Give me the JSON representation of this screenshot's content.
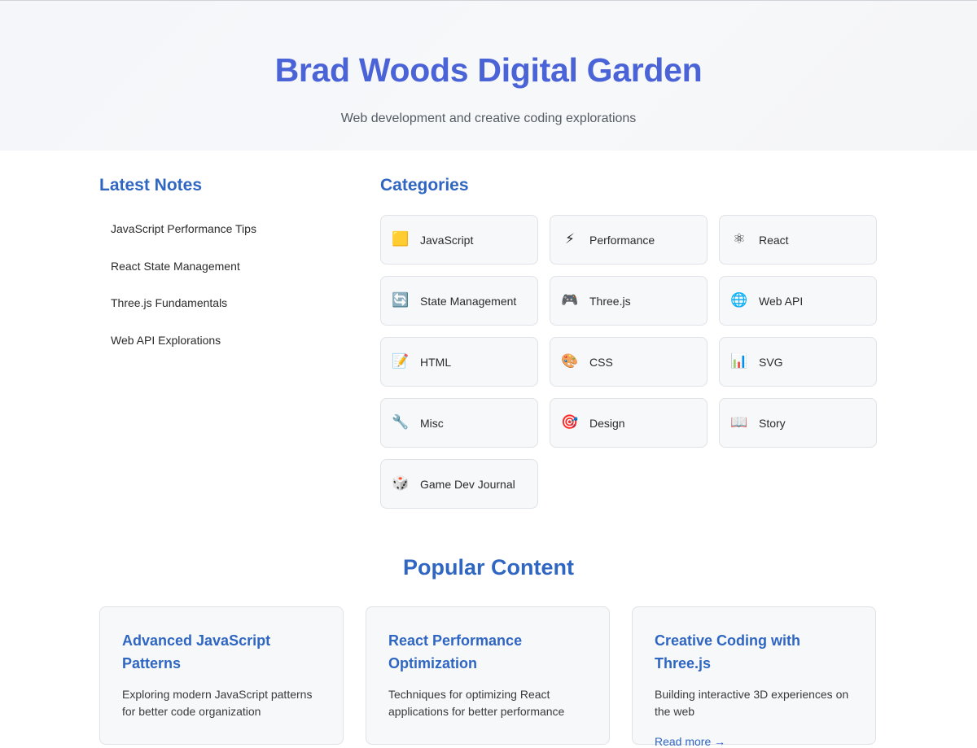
{
  "hero": {
    "title": "Brad Woods Digital Garden",
    "subtitle": "Web development and creative coding explorations"
  },
  "latest_notes": {
    "heading": "Latest Notes",
    "items": [
      {
        "label": "JavaScript Performance Tips"
      },
      {
        "label": "React State Management"
      },
      {
        "label": "Three.js Fundamentals"
      },
      {
        "label": "Web API Explorations"
      }
    ]
  },
  "categories": {
    "heading": "Categories",
    "items": [
      {
        "icon": "🟨",
        "icon_name": "yellow-square-icon",
        "label": "JavaScript"
      },
      {
        "icon": "⚡",
        "icon_name": "lightning-icon",
        "label": "Performance"
      },
      {
        "icon": "⚛",
        "icon_name": "atom-icon",
        "label": "React"
      },
      {
        "icon": "🔄",
        "icon_name": "refresh-arrows-icon",
        "label": "State Management"
      },
      {
        "icon": "🎮",
        "icon_name": "gamepad-icon",
        "label": "Three.js"
      },
      {
        "icon": "🌐",
        "icon_name": "globe-icon",
        "label": "Web API"
      },
      {
        "icon": "📝",
        "icon_name": "memo-icon",
        "label": "HTML"
      },
      {
        "icon": "🎨",
        "icon_name": "palette-icon",
        "label": "CSS"
      },
      {
        "icon": "📊",
        "icon_name": "bar-chart-icon",
        "label": "SVG"
      },
      {
        "icon": "🔧",
        "icon_name": "wrench-icon",
        "label": "Misc"
      },
      {
        "icon": "🎯",
        "icon_name": "target-icon",
        "label": "Design"
      },
      {
        "icon": "📖",
        "icon_name": "open-book-icon",
        "label": "Story"
      },
      {
        "icon": "🎲",
        "icon_name": "dice-icon",
        "label": "Game Dev Journal"
      }
    ]
  },
  "popular": {
    "heading": "Popular Content",
    "cards": [
      {
        "title": "Advanced JavaScript Patterns",
        "description": "Exploring modern JavaScript patterns for better code organization",
        "link": ""
      },
      {
        "title": "React Performance Optimization",
        "description": "Techniques for optimizing React applications for better performance",
        "link": ""
      },
      {
        "title": "Creative Coding with Three.js",
        "description": "Building interactive 3D experiences on the web",
        "link": "Read more →"
      }
    ]
  }
}
